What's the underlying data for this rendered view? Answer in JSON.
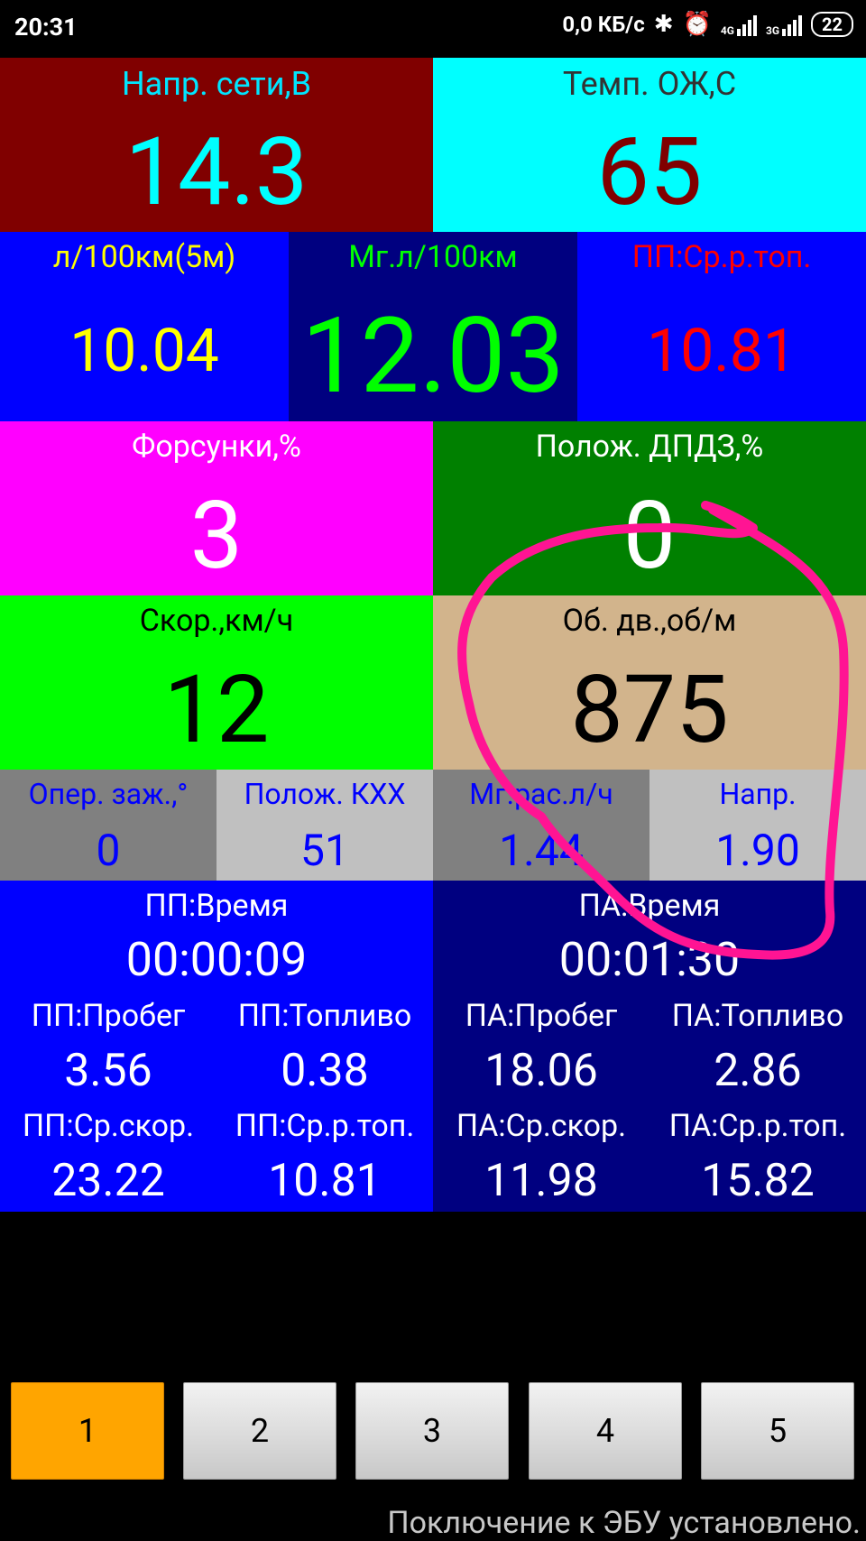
{
  "status_bar": {
    "time": "20:31",
    "net_speed": "0,0 КБ/с",
    "net_type_1": "4G",
    "net_type_2": "3G",
    "battery": "22"
  },
  "tiles": {
    "voltage": {
      "label": "Напр. сети,В",
      "value": "14.3"
    },
    "coolant_temp": {
      "label": "Темп. ОЖ,С",
      "value": "65"
    },
    "fuel_5m": {
      "label": "л/100км(5м)",
      "value": "10.04"
    },
    "instant_fuel": {
      "label": "Мг.л/100км",
      "value": "12.03"
    },
    "trip_avg_fuel": {
      "label": "ПП:Ср.р.топ.",
      "value": "10.81"
    },
    "injectors": {
      "label": "Форсунки,%",
      "value": "3"
    },
    "throttle": {
      "label": "Полож. ДПДЗ,%",
      "value": "0"
    },
    "speed": {
      "label": "Скор.,км/ч",
      "value": "12"
    },
    "rpm": {
      "label": "Об. дв.,об/м",
      "value": "875"
    },
    "ignition": {
      "label": "Опер. заж.,°",
      "value": "0"
    },
    "iac": {
      "label": "Полож. КХХ",
      "value": "51"
    },
    "instant_flow": {
      "label": "Мг.рас.л/ч",
      "value": "1.44"
    },
    "sensor_voltage": {
      "label": "Напр.",
      "value": "1.90"
    }
  },
  "trip_pp": {
    "time_label": "ПП:Время",
    "time_value": "00:00:09",
    "dist_label": "ПП:Пробег",
    "dist_value": "3.56",
    "fuel_label": "ПП:Топливо",
    "fuel_value": "0.38",
    "avg_speed_label": "ПП:Ср.скор.",
    "avg_speed_value": "23.22",
    "avg_fuel_label": "ПП:Ср.р.топ.",
    "avg_fuel_value": "10.81"
  },
  "trip_pa": {
    "time_label": "ПА:Время",
    "time_value": "00:01:30",
    "dist_label": "ПА:Пробег",
    "dist_value": "18.06",
    "fuel_label": "ПА:Топливо",
    "fuel_value": "2.86",
    "avg_speed_label": "ПА:Ср.скор.",
    "avg_speed_value": "11.98",
    "avg_fuel_label": "ПА:Ср.р.топ.",
    "avg_fuel_value": "15.82"
  },
  "pages": [
    "1",
    "2",
    "3",
    "4",
    "5"
  ],
  "active_page": 0,
  "footer_status": "Поключение к ЭБУ установлено.",
  "colors": {
    "annotation": "#ff1493",
    "active_button": "#ffa500"
  }
}
